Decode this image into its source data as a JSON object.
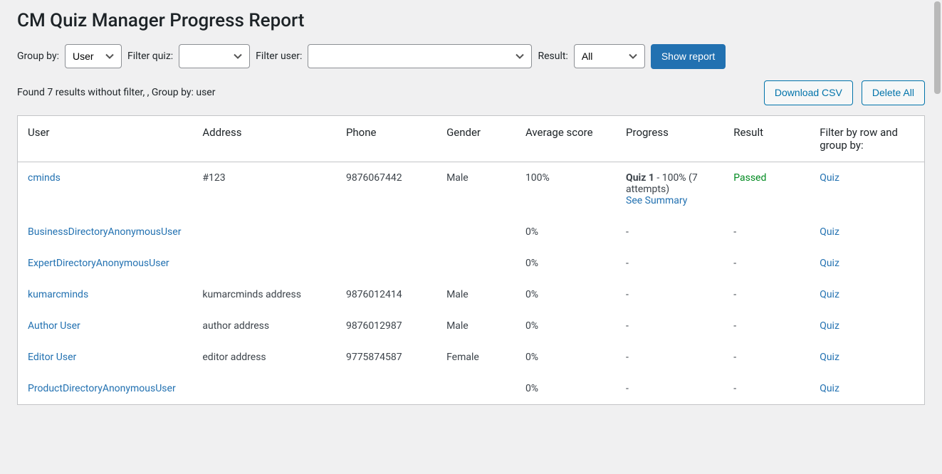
{
  "header": {
    "title": "CM Quiz Manager Progress Report"
  },
  "filters": {
    "group_by_label": "Group by:",
    "group_by_value": "User",
    "filter_quiz_label": "Filter quiz:",
    "filter_quiz_value": "",
    "filter_user_label": "Filter user:",
    "filter_user_value": "",
    "result_label": "Result:",
    "result_value": "All",
    "show_report_label": "Show report"
  },
  "meta": {
    "summary": "Found 7 results without filter, , Group by: user",
    "download_csv_label": "Download CSV",
    "delete_all_label": "Delete All"
  },
  "table": {
    "headers": {
      "user": "User",
      "address": "Address",
      "phone": "Phone",
      "gender": "Gender",
      "avg_score": "Average score",
      "progress": "Progress",
      "result": "Result",
      "filter_row": "Filter by row and group by:"
    },
    "rows": [
      {
        "user": "cminds",
        "address": "#123",
        "phone": "9876067442",
        "gender": "Male",
        "avg_score": "100%",
        "progress_quiz_label": "Quiz 1",
        "progress_detail": " - 100% (7 attempts)",
        "see_summary": "See Summary",
        "result": "Passed",
        "result_class": "passed",
        "filter_link": "Quiz"
      },
      {
        "user": "BusinessDirectoryAnonymousUser",
        "address": "",
        "phone": "",
        "gender": "",
        "avg_score": "0%",
        "progress_dash": "-",
        "result": "-",
        "filter_link": "Quiz"
      },
      {
        "user": "ExpertDirectoryAnonymousUser",
        "address": "",
        "phone": "",
        "gender": "",
        "avg_score": "0%",
        "progress_dash": "-",
        "result": "-",
        "filter_link": "Quiz"
      },
      {
        "user": "kumarcminds",
        "address": "kumarcminds address",
        "phone": "9876012414",
        "gender": "Male",
        "avg_score": "0%",
        "progress_dash": "-",
        "result": "-",
        "filter_link": "Quiz"
      },
      {
        "user": "Author User",
        "address": "author address",
        "phone": "9876012987",
        "gender": "Male",
        "avg_score": "0%",
        "progress_dash": "-",
        "result": "-",
        "filter_link": "Quiz"
      },
      {
        "user": "Editor User",
        "address": "editor address",
        "phone": "9775874587",
        "gender": "Female",
        "avg_score": "0%",
        "progress_dash": "-",
        "result": "-",
        "filter_link": "Quiz"
      },
      {
        "user": "ProductDirectoryAnonymousUser",
        "address": "",
        "phone": "",
        "gender": "",
        "avg_score": "0%",
        "progress_dash": "-",
        "result": "-",
        "filter_link": "Quiz"
      }
    ]
  }
}
